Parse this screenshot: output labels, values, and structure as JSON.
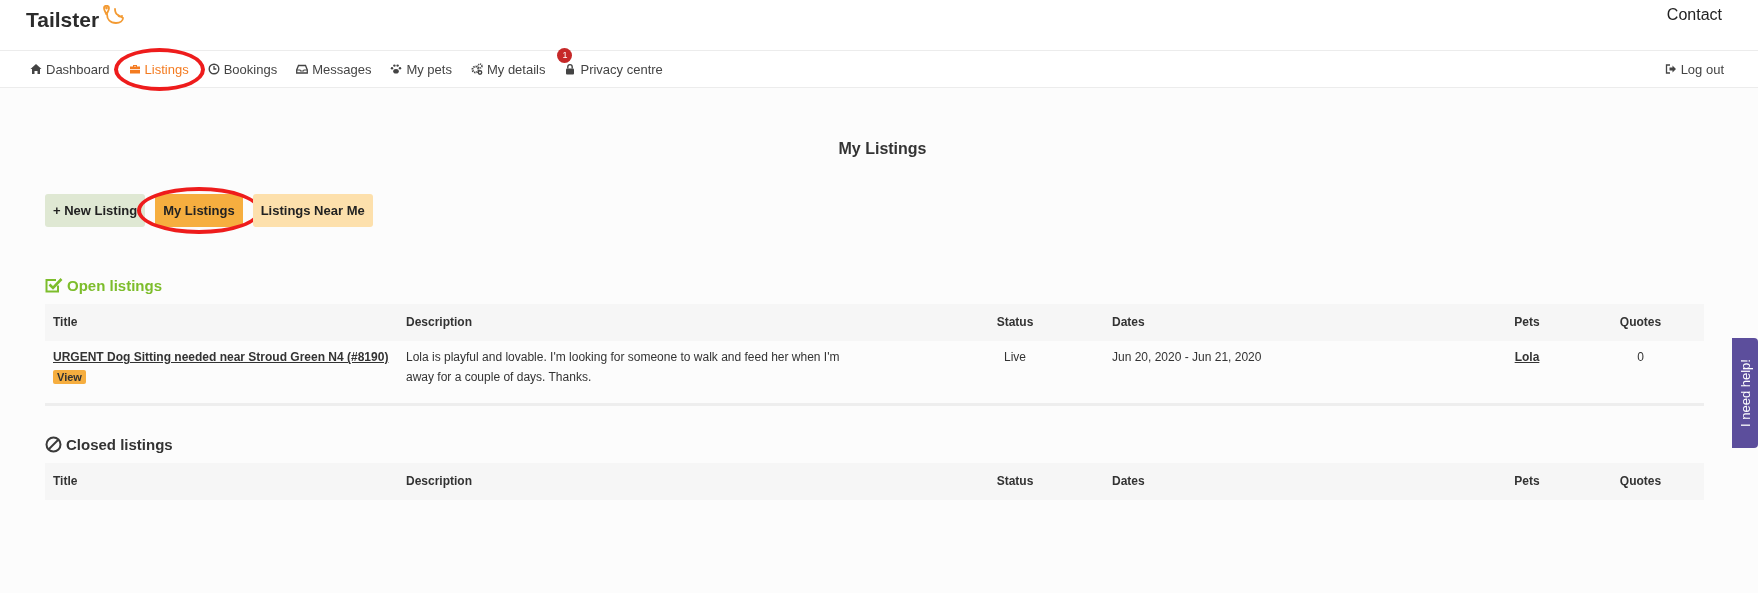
{
  "header": {
    "logo": "Tailster",
    "contact": "Contact"
  },
  "nav": {
    "items": [
      {
        "label": "Dashboard",
        "selected": false,
        "circled": false
      },
      {
        "label": "Listings",
        "selected": true,
        "circled": true
      },
      {
        "label": "Bookings",
        "selected": false,
        "circled": false
      },
      {
        "label": "Messages",
        "selected": false,
        "circled": false
      },
      {
        "label": "My pets",
        "selected": false,
        "circled": false
      },
      {
        "label": "My details",
        "selected": false,
        "circled": false
      },
      {
        "label": "Privacy centre",
        "selected": false,
        "circled": false,
        "badge": "1"
      }
    ],
    "logout": "Log out"
  },
  "page_title": "My Listings",
  "actions": [
    {
      "label": "+ New Listing",
      "kind": "create",
      "selected": false,
      "circled": false
    },
    {
      "label": "My Listings",
      "kind": "filter",
      "selected": true,
      "circled": true
    },
    {
      "label": "Listings Near Me",
      "kind": "filter",
      "selected": false,
      "circled": false
    }
  ],
  "sections": [
    {
      "heading": "Open listings",
      "kind": "open",
      "columns": [
        "Title",
        "Description",
        "Status",
        "Dates",
        "Pets",
        "Quotes"
      ],
      "rows": [
        {
          "title": "URGENT Dog Sitting needed near Stroud Green N4 (#8190)",
          "view": "View",
          "description": "Lola is playful and lovable. I'm looking for someone to walk and feed her when I'm away for a couple of days. Thanks.",
          "status": "Live",
          "dates": "Jun 20, 2020 - Jun 21, 2020",
          "pets": "Lola",
          "quotes": "0"
        }
      ]
    },
    {
      "heading": "Closed listings",
      "kind": "closed",
      "columns": [
        "Title",
        "Description",
        "Status",
        "Dates",
        "Pets",
        "Quotes"
      ]
    }
  ],
  "help_tab": "I need help!"
}
